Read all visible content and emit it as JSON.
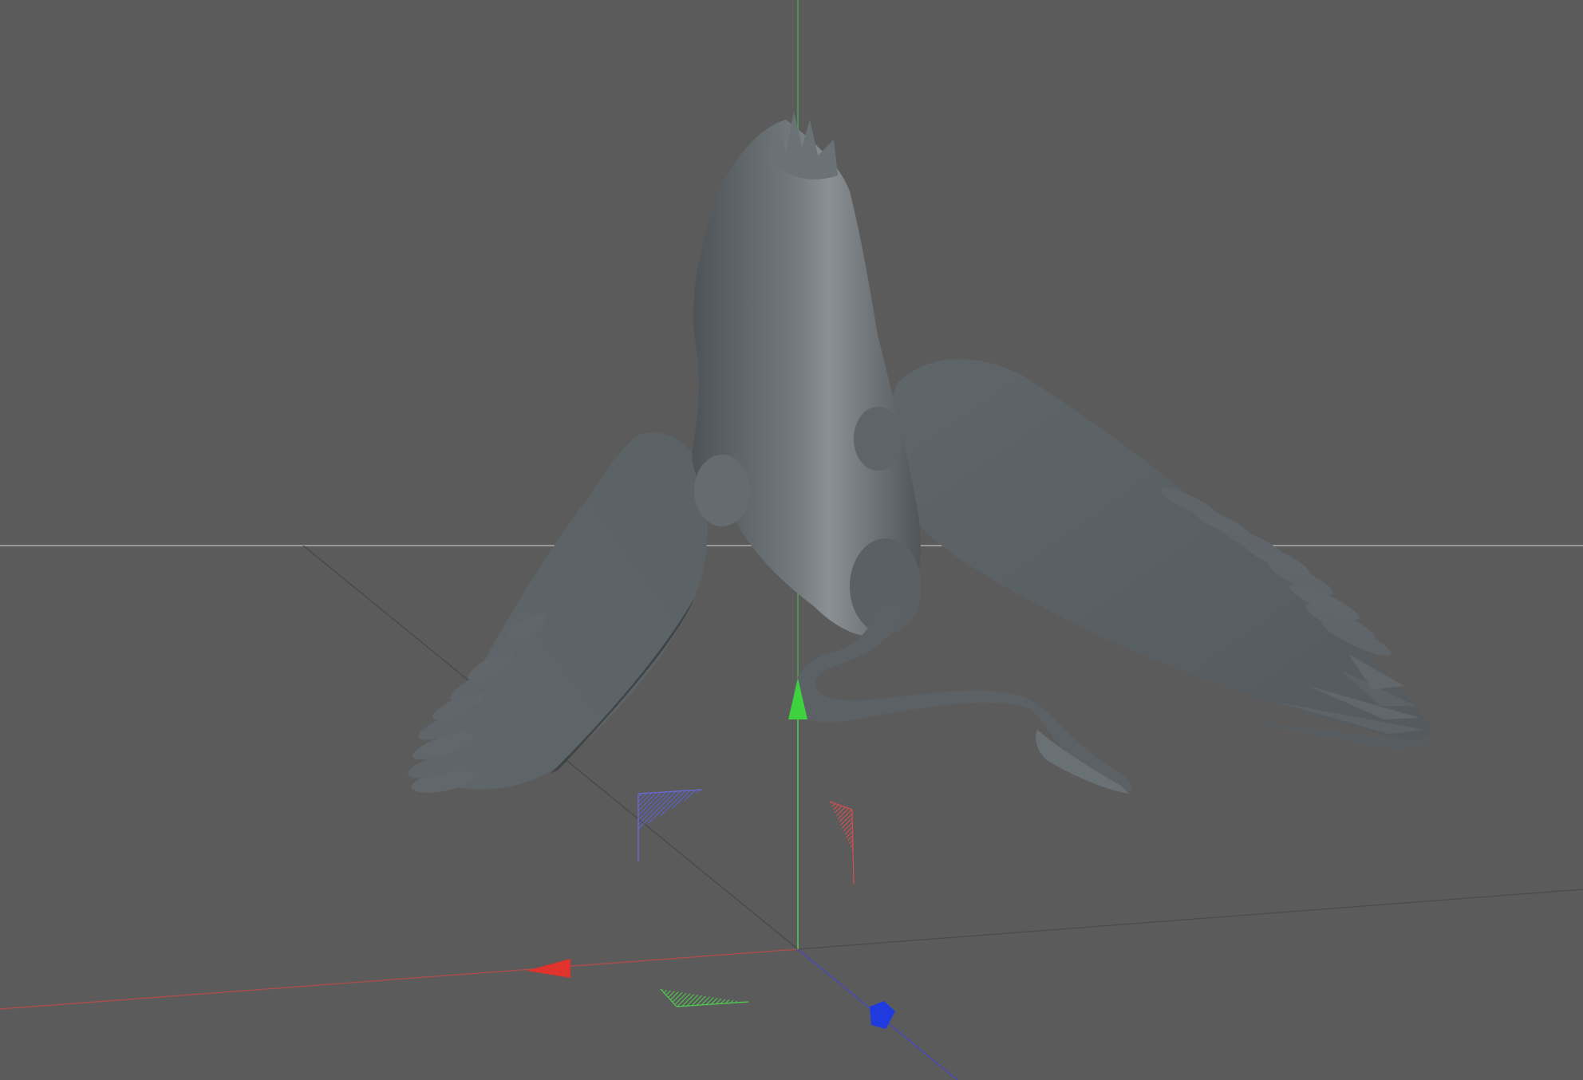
{
  "viewport": {
    "background": "#5b5b5b",
    "model_color": "#5d6266",
    "horizon_color": "#c8c8c8"
  },
  "gizmo": {
    "x_axis_color": "#e0332b",
    "y_axis_color": "#3fd23f",
    "z_axis_color": "#1f3be0"
  },
  "icons": {
    "x_handle": "x-axis-arrow-icon",
    "y_handle": "y-axis-arrow-icon",
    "z_handle": "z-axis-arrow-icon",
    "xy_plane": "xy-plane-handle-icon",
    "yz_plane": "yz-plane-handle-icon",
    "xz_plane": "xz-plane-handle-icon"
  }
}
